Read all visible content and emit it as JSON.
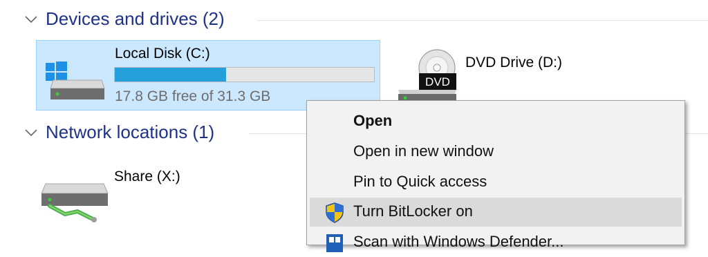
{
  "groups": {
    "devices": {
      "title": "Devices and drives (2)"
    },
    "network": {
      "title": "Network locations (1)"
    }
  },
  "drives": [
    {
      "name": "Local Disk (C:)",
      "free_text": "17.8 GB free of 31.3 GB",
      "used_fraction": 0.43,
      "selected": true,
      "icon": "windows-drive-icon"
    },
    {
      "name": "DVD Drive (D:)",
      "icon": "dvd-drive-icon",
      "disc_label": "DVD"
    }
  ],
  "network_locations": [
    {
      "name": "Share (X:)",
      "icon": "network-drive-icon"
    }
  ],
  "context_menu": {
    "items": [
      {
        "label": "Open",
        "bold": true
      },
      {
        "label": "Open in new window"
      },
      {
        "label": "Pin to Quick access"
      },
      {
        "label": "Turn BitLocker on",
        "icon": "shield-icon",
        "highlighted": true
      },
      {
        "label": "Scan with Windows Defender...",
        "icon": "defender-icon",
        "partially_visible": true
      }
    ]
  },
  "colors": {
    "group_title": "#1e3287",
    "selection_bg": "#cce8ff",
    "capacity_fill": "#26a0da",
    "menu_bg": "#f2f2f2"
  }
}
